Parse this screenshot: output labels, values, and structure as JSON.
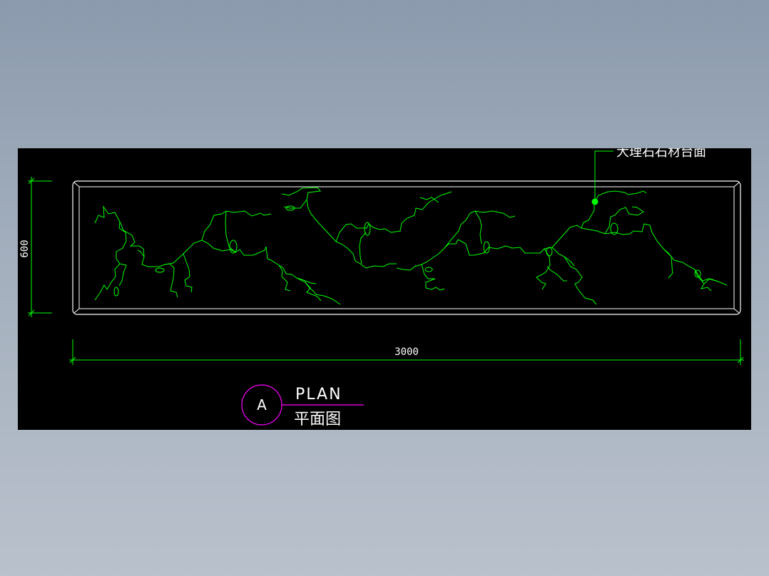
{
  "drawing": {
    "callout_label": "大理石石材台面",
    "dimension_width": "3000",
    "dimension_height": "600",
    "title_marker": "A",
    "title_en": "PLAN",
    "title_cn": "平面图"
  },
  "colors": {
    "background": "#000000",
    "outline": "#ffffff",
    "veins": "#00ff00",
    "dimension": "#00ff00",
    "marker": "#ff00ff",
    "text": "#ffffff"
  }
}
